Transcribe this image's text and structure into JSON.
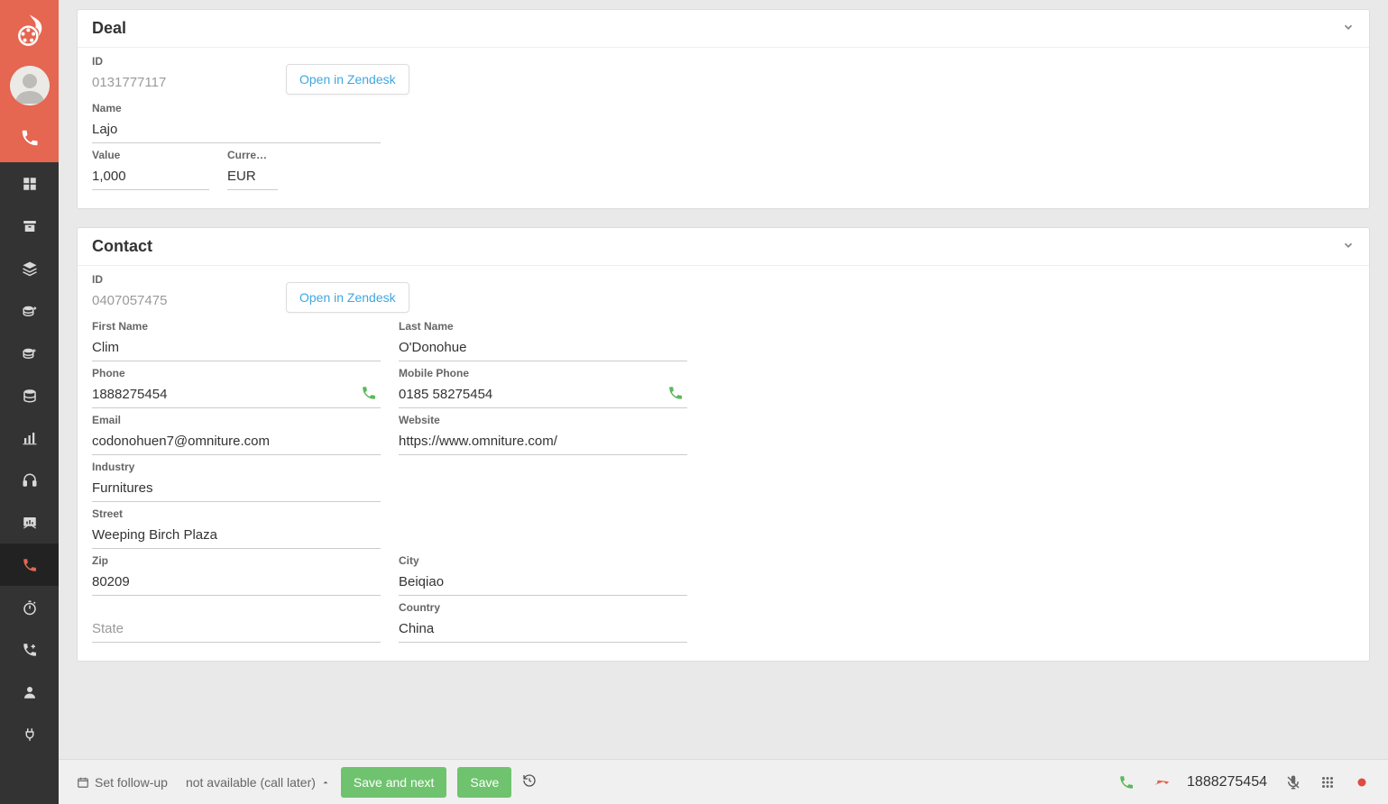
{
  "deal": {
    "header_title": "Deal",
    "id_label": "ID",
    "id_value": "0131777117",
    "open_zendesk": "Open in Zendesk",
    "name_label": "Name",
    "name_value": "Lajo",
    "value_label": "Value",
    "value_value": "1,000",
    "currency_label": "Curre…",
    "currency_value": "EUR"
  },
  "contact": {
    "header_title": "Contact",
    "id_label": "ID",
    "id_value": "0407057475",
    "open_zendesk": "Open in Zendesk",
    "first_name_label": "First Name",
    "first_name_value": "Clim",
    "last_name_label": "Last Name",
    "last_name_value": "O'Donohue",
    "phone_label": "Phone",
    "phone_value": "1888275454",
    "mobile_label": "Mobile Phone",
    "mobile_value": "0185 58275454",
    "email_label": "Email",
    "email_value": "codonohuen7@omniture.com",
    "website_label": "Website",
    "website_value": "https://www.omniture.com/",
    "industry_label": "Industry",
    "industry_value": "Furnitures",
    "street_label": "Street",
    "street_value": "Weeping Birch Plaza",
    "zip_label": "Zip",
    "zip_value": "80209",
    "city_label": "City",
    "city_value": "Beiqiao",
    "state_placeholder": "State",
    "country_label": "Country",
    "country_value": "China"
  },
  "footer": {
    "followup": "Set follow-up",
    "status": "not available (call later)",
    "save_next": "Save and next",
    "save": "Save",
    "call_number": "1888275454"
  }
}
